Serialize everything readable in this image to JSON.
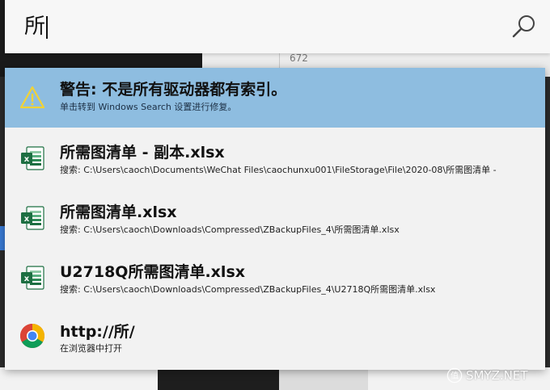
{
  "search": {
    "query": "所"
  },
  "background": {
    "number": "672"
  },
  "results": [
    {
      "type": "warning",
      "icon": "warning-icon",
      "title": "警告: 不是所有驱动器都有索引。",
      "subtitle": "单击转到 Windows Search 设置进行修复。"
    },
    {
      "type": "file",
      "icon": "excel-icon",
      "title": "所需图清单 - 副本.xlsx",
      "subtitle": "搜索: C:\\Users\\caoch\\Documents\\WeChat Files\\caochunxu001\\FileStorage\\File\\2020-08\\所需图清单 -"
    },
    {
      "type": "file",
      "icon": "excel-icon",
      "title": "所需图清单.xlsx",
      "subtitle": "搜索: C:\\Users\\caoch\\Downloads\\Compressed\\ZBackupFiles_4\\所需图清单.xlsx"
    },
    {
      "type": "file",
      "icon": "excel-icon",
      "title": "U2718Q所需图清单.xlsx",
      "subtitle": "搜索: C:\\Users\\caoch\\Downloads\\Compressed\\ZBackupFiles_4\\U2718Q所需图清单.xlsx"
    },
    {
      "type": "web",
      "icon": "chrome-icon",
      "title": "http://所/",
      "subtitle": "在浏览器中打开"
    }
  ],
  "watermark": "SMYZ.NET",
  "colors": {
    "selected_row": "#8ebde0",
    "panel": "#f2f2f2",
    "excel_green": "#1d6f42",
    "warning_yellow": "#f2d335"
  }
}
